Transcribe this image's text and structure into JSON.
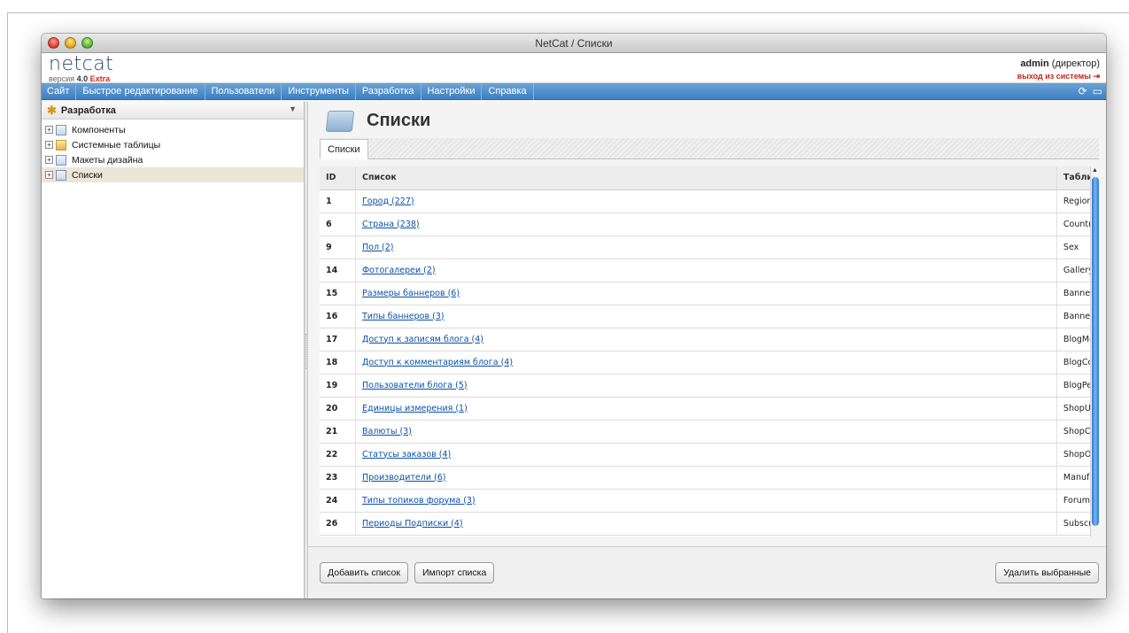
{
  "window": {
    "title": "NetCat / Списки"
  },
  "header": {
    "logo": "netcat",
    "version_prefix": "версия",
    "version": "4.0",
    "edition": "Extra",
    "user": "admin",
    "role": "(директор)",
    "logout": "выход из системы"
  },
  "menu": {
    "items": [
      "Сайт",
      "Быстрое редактирование",
      "Пользователи",
      "Инструменты",
      "Разработка",
      "Настройки",
      "Справка"
    ]
  },
  "sidebar": {
    "title": "Разработка",
    "items": [
      {
        "label": "Компоненты"
      },
      {
        "label": "Системные таблицы"
      },
      {
        "label": "Макеты дизайна"
      },
      {
        "label": "Списки"
      }
    ]
  },
  "main": {
    "title": "Списки",
    "tab": "Списки",
    "columns": {
      "id": "ID",
      "list": "Список",
      "table": "Таблица"
    },
    "rows": [
      {
        "id": "1",
        "name": "Город (227)",
        "table": "Region"
      },
      {
        "id": "6",
        "name": "Страна (238)",
        "table": "Country"
      },
      {
        "id": "9",
        "name": "Пол (2)",
        "table": "Sex"
      },
      {
        "id": "14",
        "name": "Фотогалереи (2)",
        "table": "Gallery"
      },
      {
        "id": "15",
        "name": "Размеры баннеров (6)",
        "table": "BannerSize"
      },
      {
        "id": "16",
        "name": "Типы баннеров (3)",
        "table": "BannerType"
      },
      {
        "id": "17",
        "name": "Доступ к записям блога (4)",
        "table": "BlogMessagesAccess"
      },
      {
        "id": "18",
        "name": "Доступ к комментариям блога (4)",
        "table": "BlogCommentsAccess"
      },
      {
        "id": "19",
        "name": "Пользователи блога (5)",
        "table": "BlogPermissionGroup"
      },
      {
        "id": "20",
        "name": "Единицы измерения (1)",
        "table": "ShopUnits"
      },
      {
        "id": "21",
        "name": "Валюты (3)",
        "table": "ShopCurrency"
      },
      {
        "id": "22",
        "name": "Статусы заказов (4)",
        "table": "ShopOrderStatus"
      },
      {
        "id": "23",
        "name": "Производители (6)",
        "table": "Manufacturer"
      },
      {
        "id": "24",
        "name": "Типы топиков форума (3)",
        "table": "ForumTopicType"
      },
      {
        "id": "26",
        "name": "Периоды Подписки (4)",
        "table": "SubscriberPeriod"
      }
    ]
  },
  "footer": {
    "add": "Добавить список",
    "import": "Импорт списка",
    "delete": "Удалить выбранные"
  },
  "icons": {
    "delete": "✖",
    "refresh": "⟳",
    "chat": "▭",
    "logout": "⇥"
  }
}
